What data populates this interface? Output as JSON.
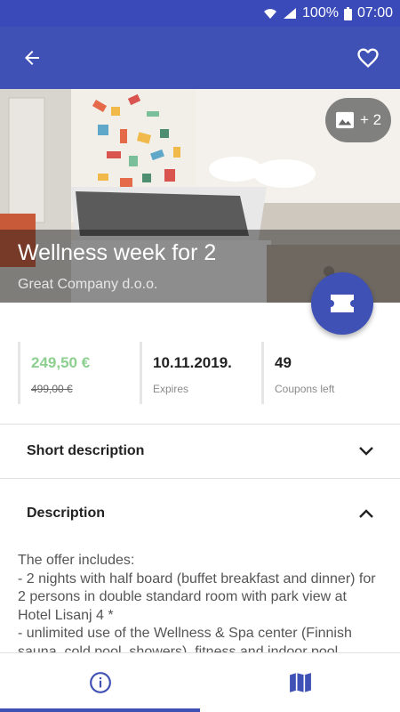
{
  "status_bar": {
    "battery": "100%",
    "time": "07:00"
  },
  "app_bar": {
    "back_icon": "back-arrow-icon",
    "favorite_icon": "heart-outline-icon"
  },
  "hero": {
    "title": "Wellness week for 2",
    "company": "Great Company d.o.o.",
    "gallery_count": "+ 2"
  },
  "stats": {
    "price": "249,50 €",
    "old_price": "499,00 €",
    "expires": "10.11.2019.",
    "expires_label": "Expires",
    "coupons": "49",
    "coupons_label": "Coupons left"
  },
  "sections": {
    "short_description": "Short description",
    "description": "Description"
  },
  "description_text": "The offer includes:\n- 2 nights with half board (buffet breakfast and dinner) for 2 persons in double standard room with park view at Hotel Lisanj 4 *\n- unlimited use of the Wellness & Spa center (Finnish sauna, cold pool, showers), fitness and indoor pool",
  "colors": {
    "primary": "#3f51b5",
    "status": "#3a4ab8",
    "price": "#8ccf8f"
  },
  "bottom_nav": {
    "tabs": [
      "info-icon",
      "map-icon"
    ],
    "selected": 0
  }
}
